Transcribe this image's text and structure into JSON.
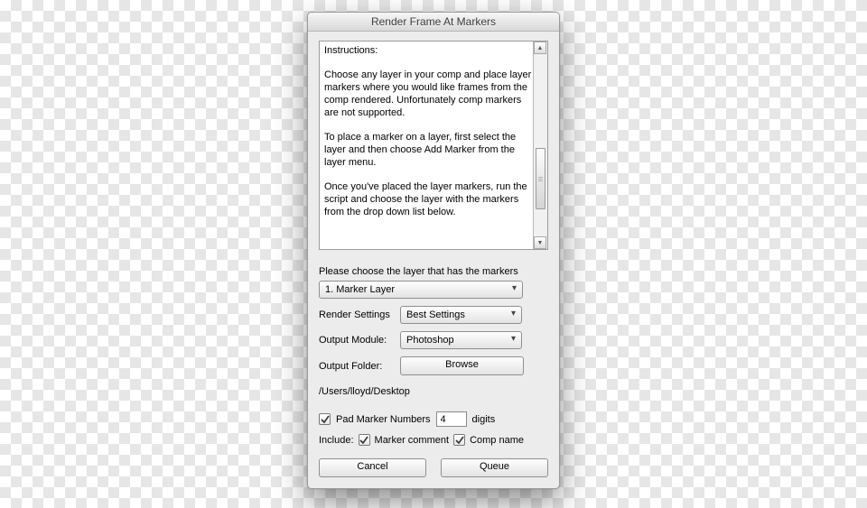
{
  "window": {
    "title": "Render Frame At Markers"
  },
  "instructions": {
    "heading": "Instructions:",
    "p1": "Choose any layer in your comp and place layer markers where you would like frames from the comp rendered.  Unfortunately comp markers are not supported.",
    "p2": "To place a marker on a layer, first select the layer and then choose Add Marker from the layer menu.",
    "p3": "Once you've placed the layer markers, run the script and choose the layer with the markers from the drop down list below."
  },
  "layer_prompt": "Please choose the layer that has the markers",
  "layer_dropdown": {
    "selected": "1. Marker Layer"
  },
  "render_settings": {
    "label": "Render Settings",
    "selected": "Best Settings"
  },
  "output_module": {
    "label": "Output Module:",
    "selected": "Photoshop"
  },
  "output_folder": {
    "label": "Output Folder:",
    "button": "Browse",
    "path": "/Users/lloyd/Desktop"
  },
  "pad": {
    "label": "Pad Marker Numbers",
    "value": "4",
    "unit": "digits"
  },
  "include": {
    "label": "Include:",
    "marker_comment": "Marker comment",
    "comp_name": "Comp name"
  },
  "buttons": {
    "cancel": "Cancel",
    "queue": "Queue"
  }
}
